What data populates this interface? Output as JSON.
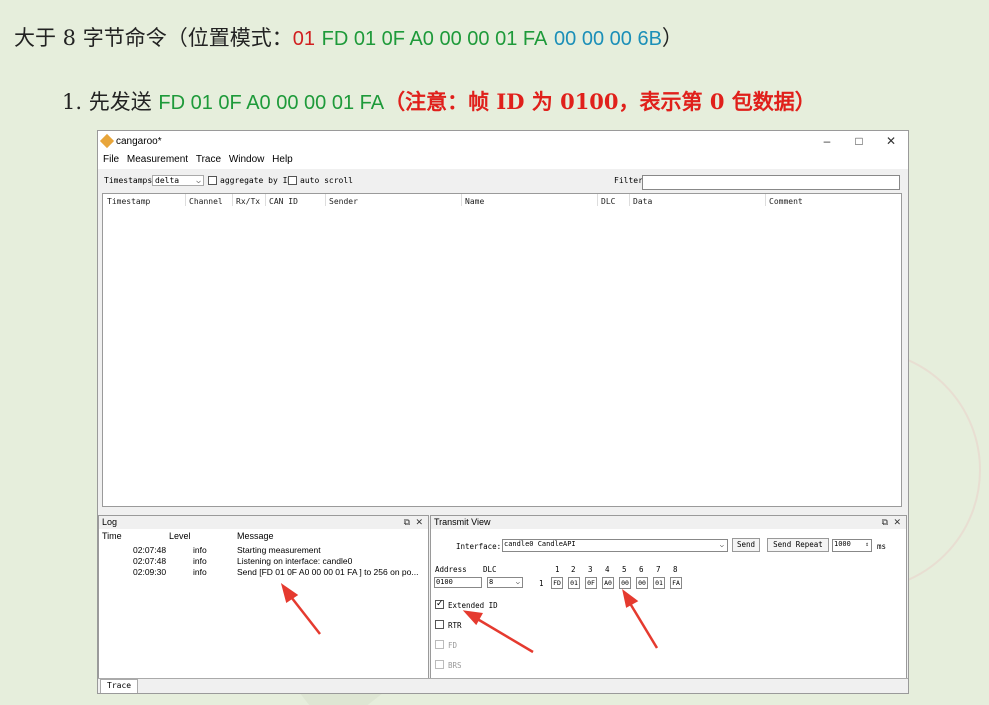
{
  "doc": {
    "line1_prefix": "大于 8 字节命令（位置模式：",
    "line1_red": "01",
    "line1_green": "FD 01 0F A0 00 00 01 FA",
    "line1_blue": "00 00 00 6B",
    "line1_suffix": "）",
    "line2_prefix": "1.  先发送",
    "line2_green": "FD 01 0F A0 00 00 01 FA",
    "line2_note": "（注意：帧 ID 为 0100，表示第 0 包数据）"
  },
  "window": {
    "title": "cangaroo*",
    "controls": {
      "minimize": "–",
      "maximize": "□",
      "close": "✕"
    }
  },
  "menu": [
    "File",
    "Measurement",
    "Trace",
    "Window",
    "Help"
  ],
  "toolbar": {
    "timestamps_label": "Timestamps:",
    "timestamps_value": "delta",
    "aggregate_label": "aggregate by ID",
    "autoscroll_label": "auto scroll",
    "filter_label": "Filter:"
  },
  "trace_columns": [
    "Timestamp",
    "Channel",
    "Rx/Tx",
    "CAN ID",
    "Sender",
    "Name",
    "DLC",
    "Data",
    "Comment"
  ],
  "log": {
    "title": "Log",
    "headers": [
      "Time",
      "Level",
      "Message"
    ],
    "rows": [
      {
        "time": "02:07:48",
        "level": "info",
        "message": "Starting measurement"
      },
      {
        "time": "02:07:48",
        "level": "info",
        "message": "Listening on interface: candle0"
      },
      {
        "time": "02:09:30",
        "level": "info",
        "message": "Send [FD 01 0F A0 00 00 01 FA ] to 256 on po..."
      }
    ]
  },
  "transmit": {
    "title": "Transmit View",
    "interface_label": "Interface:",
    "interface_value": "candle0 CandleAPI",
    "send_label": "Send",
    "send_repeat_label": "Send Repeat",
    "repeat_value": "1000",
    "repeat_unit": "ms",
    "address_label": "Address",
    "dlc_label": "DLC",
    "address_value": "0100",
    "dlc_value": "8",
    "byte_index_prefix": "1",
    "byte_indices": [
      "1",
      "2",
      "3",
      "4",
      "5",
      "6",
      "7",
      "8"
    ],
    "bytes": [
      "FD",
      "01",
      "0F",
      "A0",
      "00",
      "00",
      "01",
      "FA"
    ],
    "extended_id_label": "Extended ID",
    "rtr_label": "RTR",
    "fd_label": "FD",
    "brs_label": "BRS"
  },
  "pane_icons": {
    "float": "⧉",
    "close": "✕"
  },
  "tabs": [
    "Trace"
  ],
  "colors": {
    "red": "#d11f1f",
    "green": "#1e9a3a",
    "blue": "#1b8fb8",
    "arrow": "#e53a2f"
  }
}
